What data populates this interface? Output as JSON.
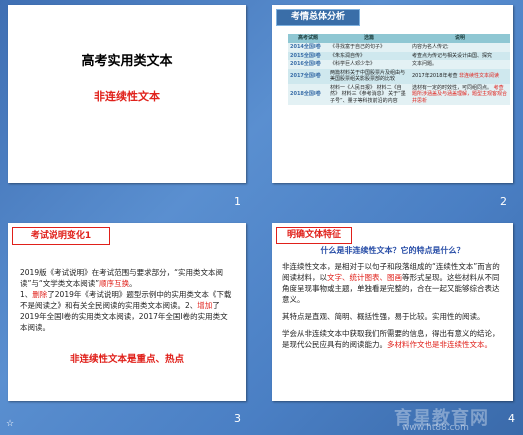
{
  "slide1": {
    "title": "高考实用类文本",
    "subtitle": "非连续性文本",
    "number": "1"
  },
  "slide2": {
    "tag": "考情总体分析",
    "number": "2",
    "headers": [
      "高考试题",
      "选篇",
      "说明"
    ],
    "rows": [
      {
        "year": "2014全国Ⅰ卷",
        "material": "《寻找富于自己的句子》",
        "desc": "内容为名人传记;"
      },
      {
        "year": "2015全国Ⅰ卷",
        "material": "《朱东润自传》",
        "desc": "考查点为传记与相关设计由国、探究"
      },
      {
        "year": "2016全国Ⅰ卷",
        "material": "《科学巨人邓少华》",
        "desc": "文本问题。"
      },
      {
        "year": "2017全国Ⅰ卷",
        "material": "两篇材料关于中国股票片及组由与美国股票组关影股票部的比较",
        "desc": "2017年2018年考查",
        "desc_red": "非连续性文本阅读"
      },
      {
        "year": "2018全国Ⅰ卷",
        "material": "材料一《人民日报》 材料二《自然》 材料三《参考消息》 关于“墨子号”、量子等科技前沿的内容",
        "desc": "选材有一定的时效性，可同组同点。",
        "desc_red": "考查题所涉涵盖及与涵盖理解，题型主观客观合并思析"
      }
    ]
  },
  "slide3": {
    "tag": "考试说明变化1",
    "number": "3",
    "para1_a": "2019版《考试说明》在考试范围与要求部分，“实用类文本阅读”与“文学类文本阅读”",
    "para1_red": "顺序互换",
    "para1_b": "。",
    "para2_a": "1、",
    "para2_red1": "删除",
    "para2_b": "了2019年《考试说明》题型示例中的实用类文本《下载不是阅读之》和有关全民阅读的实用类文本阅读。2、",
    "para2_red2": "增加",
    "para2_c": "了2019年全国Ⅰ卷的实用类文本阅读，2017年全国Ⅰ卷的实用类文本阅读。",
    "key_point": "非连续性文本是重点、热点"
  },
  "slide4": {
    "tag": "明确文体特征",
    "number": "4",
    "question": "什么是非连续性文本？它的特点是什么？",
    "p1_a": "非连续性文本，是相对于以句子和段落组成的“连续性文本”而言的阅读材料，以",
    "p1_red": "文字、统计图表、图画",
    "p1_b": "等形式呈现。这些材料从不同角度呈现事物或主题，单独看是完整的，合在一起又能够综合表达意义。",
    "p2": "其特点是直观、简明、概括性强，易于比较。实用性的阅读。",
    "p3_a": "学会从非连续文本中获取我们所需要的信息，得出有意义的结论，是现代公民应具有的阅读能力。",
    "p3_red": "多材料作文也是非连续性文本。"
  },
  "watermark": {
    "line1": "育星教育网",
    "line2": "www.ht88.com"
  }
}
